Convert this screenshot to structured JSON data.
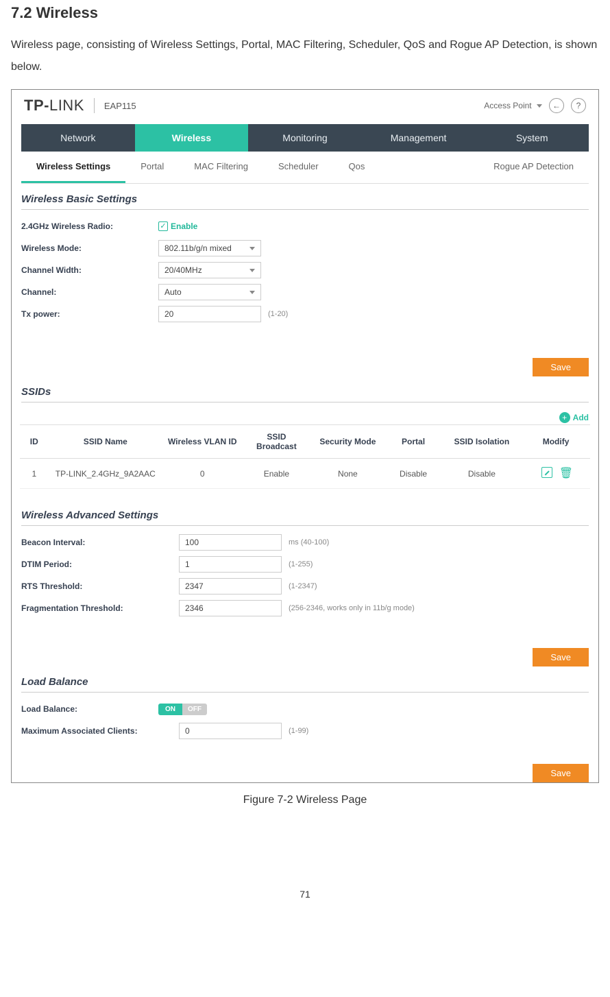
{
  "doc": {
    "heading": "7.2  Wireless",
    "intro": "Wireless page, consisting of Wireless Settings, Portal, MAC Filtering, Scheduler, QoS and Rogue AP Detection, is shown below.",
    "caption": "Figure 7-2 Wireless Page",
    "page_num": "71"
  },
  "header": {
    "brand1": "TP-",
    "brand2": "LINK",
    "model": "EAP115",
    "role": "Access Point",
    "help_glyph": "?",
    "logout_glyph": "←"
  },
  "main_nav": [
    "Network",
    "Wireless",
    "Monitoring",
    "Management",
    "System"
  ],
  "main_nav_active": 1,
  "sub_nav": [
    "Wireless Settings",
    "Portal",
    "MAC Filtering",
    "Scheduler",
    "Qos",
    "Rogue AP Detection"
  ],
  "sub_nav_active": 0,
  "basic": {
    "title": "Wireless Basic Settings",
    "radio_label": "2.4GHz Wireless Radio:",
    "enable": "Enable",
    "mode_label": "Wireless Mode:",
    "mode_val": "802.11b/g/n mixed",
    "width_label": "Channel Width:",
    "width_val": "20/40MHz",
    "channel_label": "Channel:",
    "channel_val": "Auto",
    "tx_label": "Tx power:",
    "tx_val": "20",
    "tx_hint": "(1-20)",
    "save": "Save"
  },
  "ssids": {
    "title": "SSIDs",
    "add": "Add",
    "plus": "+",
    "headers": [
      "ID",
      "SSID Name",
      "Wireless VLAN ID",
      "SSID Broadcast",
      "Security Mode",
      "Portal",
      "SSID Isolation",
      "Modify"
    ],
    "rows": [
      {
        "id": "1",
        "name": "TP-LINK_2.4GHz_9A2AAC",
        "vlan": "0",
        "broadcast": "Enable",
        "security": "None",
        "portal": "Disable",
        "isolation": "Disable"
      }
    ]
  },
  "advanced": {
    "title": "Wireless Advanced Settings",
    "beacon_label": "Beacon Interval:",
    "beacon_val": "100",
    "beacon_hint": "ms (40-100)",
    "dtim_label": "DTIM Period:",
    "dtim_val": "1",
    "dtim_hint": "(1-255)",
    "rts_label": "RTS Threshold:",
    "rts_val": "2347",
    "rts_hint": "(1-2347)",
    "frag_label": "Fragmentation Threshold:",
    "frag_val": "2346",
    "frag_hint": "(256-2346, works only in 11b/g mode)",
    "save": "Save"
  },
  "loadbal": {
    "title": "Load Balance",
    "lb_label": "Load Balance:",
    "on": "ON",
    "off": "OFF",
    "max_label": "Maximum Associated Clients:",
    "max_val": "0",
    "max_hint": "(1-99)",
    "save": "Save"
  }
}
